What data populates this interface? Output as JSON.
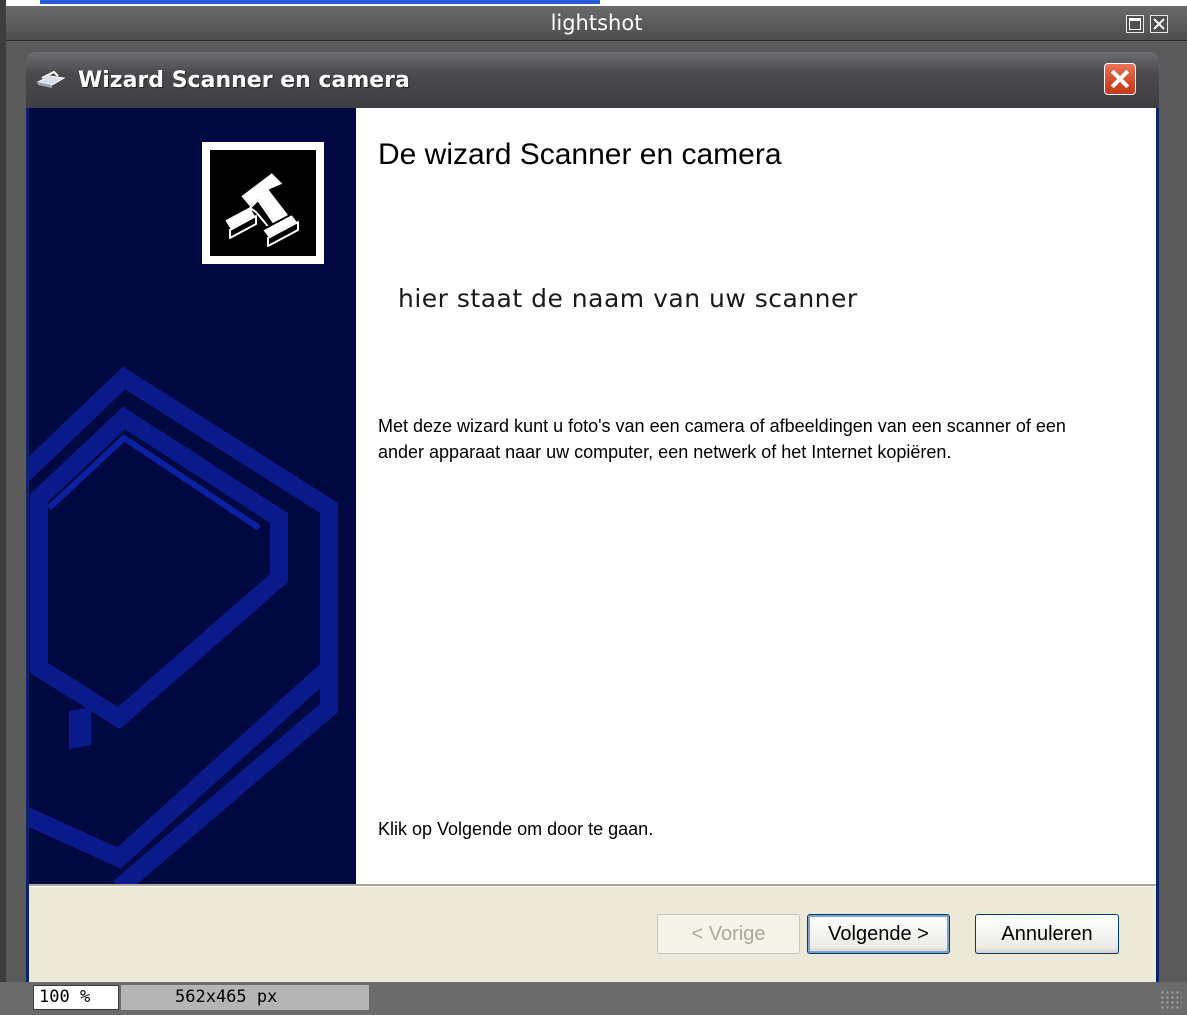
{
  "viewer": {
    "title": "lightshot",
    "zoom": "100 %",
    "image_size": "562x465 px"
  },
  "dialog": {
    "title": "Wizard Scanner en camera",
    "heading": "De wizard Scanner en camera",
    "scanner_name": "hier staat de naam van uw scanner",
    "description": "Met deze wizard kunt u foto's van een camera of afbeeldingen van een scanner of een ander apparaat naar uw computer, een netwerk of het Internet kopiëren.",
    "hint": "Klik op Volgende om door te gaan.",
    "buttons": {
      "prev": "< Vorige",
      "next": "Volgende >",
      "cancel": "Annuleren"
    }
  },
  "colors": {
    "sidebar": "#000842",
    "titlebar": "#4a4a4e",
    "close": "#d44a26",
    "button_face": "#ece9d8"
  }
}
